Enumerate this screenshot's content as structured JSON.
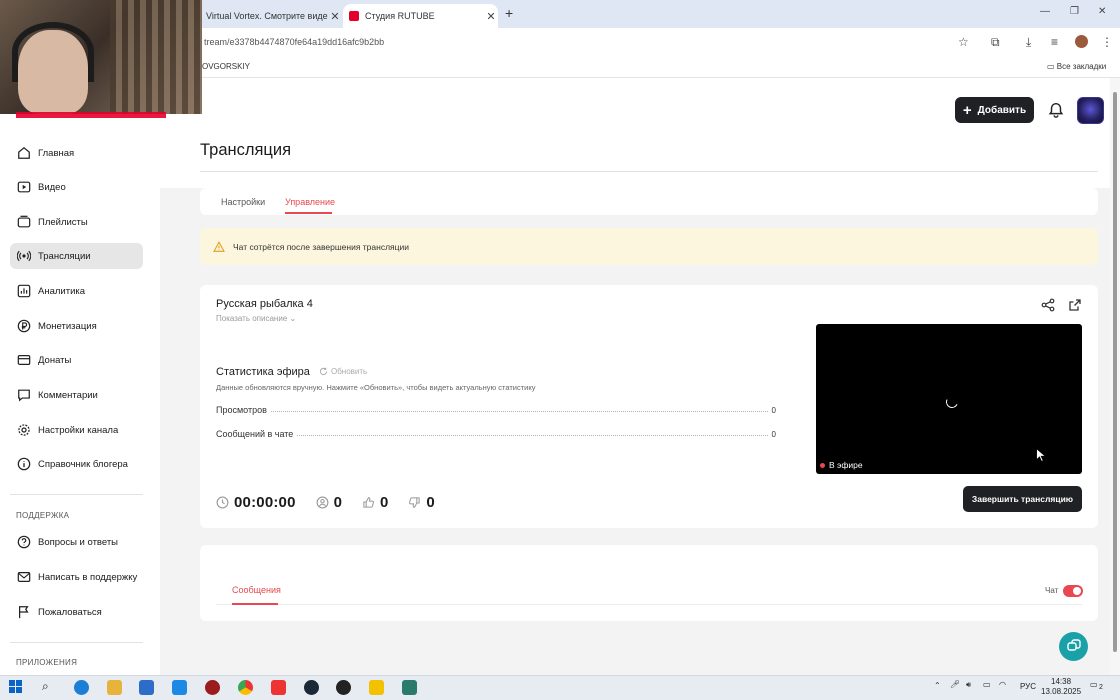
{
  "browser": {
    "tabs": [
      {
        "title": "Virtual Vortex. Смотрите видео"
      },
      {
        "title": "Студия RUTUBE"
      }
    ],
    "url": "tream/e3378b4474870fe64a19dd16afc9b2bb",
    "bookmarks": {
      "item": "OVGORSKIY",
      "all_label": "Все закладки"
    }
  },
  "header": {
    "add_label": "Добавить"
  },
  "sidebar": {
    "items": [
      {
        "label": "Главная",
        "icon": "home-icon"
      },
      {
        "label": "Видео",
        "icon": "video-icon"
      },
      {
        "label": "Плейлисты",
        "icon": "playlist-icon"
      },
      {
        "label": "Трансляции",
        "icon": "broadcast-icon"
      },
      {
        "label": "Аналитика",
        "icon": "analytics-icon"
      },
      {
        "label": "Монетизация",
        "icon": "ruble-icon"
      },
      {
        "label": "Донаты",
        "icon": "donate-icon"
      },
      {
        "label": "Комментарии",
        "icon": "comment-icon"
      },
      {
        "label": "Настройки канала",
        "icon": "gear-icon"
      },
      {
        "label": "Справочник блогера",
        "icon": "info-icon"
      }
    ],
    "support_heading": "ПОДДЕРЖКА",
    "support_items": [
      {
        "label": "Вопросы и ответы",
        "icon": "faq-icon"
      },
      {
        "label": "Написать в поддержку",
        "icon": "mail-icon"
      },
      {
        "label": "Пожаловаться",
        "icon": "flag-icon"
      }
    ],
    "apps_heading": "ПРИЛОЖЕНИЯ"
  },
  "page": {
    "title": "Трансляция",
    "tabs": [
      {
        "label": "Настройки"
      },
      {
        "label": "Управление"
      }
    ],
    "alert": "Чат сотрётся после завершения трансляции",
    "stream": {
      "title": "Русская рыбалка 4",
      "show_description": "Показать описание",
      "stats_title": "Статистика эфира",
      "refresh_label": "Обновить",
      "stats_hint": "Данные обновляются вручную. Нажмите «Обновить», чтобы видеть актуальную статистику",
      "stats": [
        {
          "label": "Просмотров",
          "value": "0"
        },
        {
          "label": "Сообщений в чате",
          "value": "0"
        }
      ],
      "timer": "00:00:00",
      "viewers": "0",
      "likes": "0",
      "dislikes": "0",
      "live_label": "В эфире",
      "end_label": "Завершить трансляцию"
    },
    "chat": {
      "tab_label": "Сообщения",
      "toggle_label": "Чат",
      "toggle_on": true
    }
  },
  "taskbar": {
    "lang": "РУС",
    "time": "14:38",
    "date": "13.08.2025",
    "notifications": "2"
  },
  "colors": {
    "accent": "#e8484f",
    "dark_button": "#202124",
    "alert_bg": "#fdf6de",
    "fab": "#1aa1a8"
  }
}
